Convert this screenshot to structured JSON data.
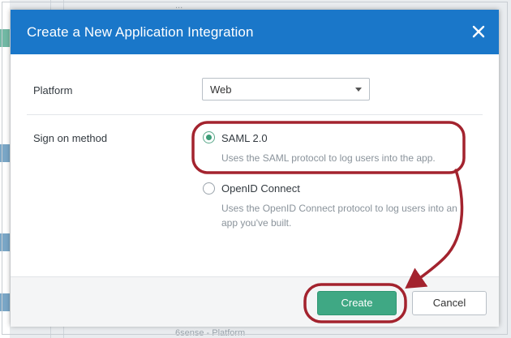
{
  "background": {
    "top_text": "...",
    "bottom_text": "6sense - Platform"
  },
  "modal": {
    "title": "Create a New Application Integration",
    "close_icon": "close-icon",
    "platform": {
      "label": "Platform",
      "selected": "Web"
    },
    "sign_on": {
      "label": "Sign on method",
      "options": [
        {
          "label": "SAML 2.0",
          "description": "Uses the SAML protocol to log users into the app.",
          "selected": true
        },
        {
          "label": "OpenID Connect",
          "description": "Uses the OpenID Connect protocol to log users into an app you've built.",
          "selected": false
        }
      ]
    },
    "footer": {
      "create_label": "Create",
      "cancel_label": "Cancel"
    }
  },
  "colors": {
    "header": "#1a77c9",
    "primary": "#3fa884",
    "annotation": "#a3232e"
  }
}
